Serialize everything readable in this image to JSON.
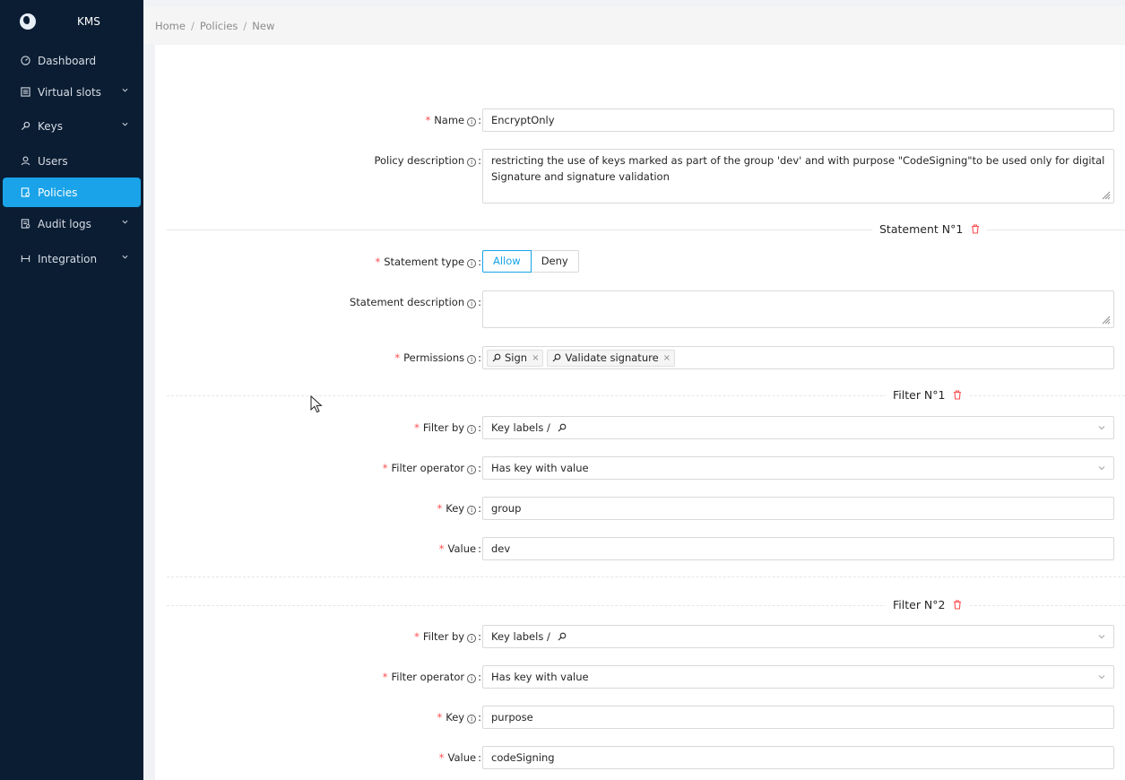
{
  "sidebar": {
    "app_title": "KMS",
    "items": [
      {
        "label": "Dashboard",
        "icon": "dashboard-icon",
        "expandable": false,
        "active": false
      },
      {
        "label": "Virtual slots",
        "icon": "slots-icon",
        "expandable": true,
        "active": false
      },
      {
        "label": "Keys",
        "icon": "key-icon",
        "expandable": true,
        "active": false
      },
      {
        "label": "Users",
        "icon": "user-icon",
        "expandable": false,
        "active": false
      },
      {
        "label": "Policies",
        "icon": "policy-icon",
        "expandable": false,
        "active": true
      },
      {
        "label": "Audit logs",
        "icon": "audit-icon",
        "expandable": true,
        "active": false
      },
      {
        "label": "Integration",
        "icon": "integration-icon",
        "expandable": true,
        "active": false
      }
    ]
  },
  "breadcrumb": [
    "Home",
    "Policies",
    "New"
  ],
  "form": {
    "name": {
      "label": "Name",
      "value": "EncryptOnly"
    },
    "policy_description": {
      "label": "Policy description",
      "value": "restricting the use of keys marked as part of the group 'dev'  and with purpose \"CodeSigning\"to be used only for digital Signature and signature validation"
    },
    "statement": {
      "title": "Statement N°1",
      "type_label": "Statement type",
      "type_options": [
        "Allow",
        "Deny"
      ],
      "type_selected": "Allow",
      "description_label": "Statement description",
      "description_value": "",
      "permissions_label": "Permissions",
      "permissions": [
        "Sign",
        "Validate signature"
      ]
    },
    "filters": [
      {
        "title": "Filter N°1",
        "filter_by_label": "Filter by",
        "filter_by_value": "Key labels /",
        "operator_label": "Filter operator",
        "operator_value": "Has key with value",
        "key_label": "Key",
        "key_value": "group",
        "value_label": "Value",
        "value_value": "dev"
      },
      {
        "title": "Filter N°2",
        "filter_by_label": "Filter by",
        "filter_by_value": "Key labels /",
        "operator_label": "Filter operator",
        "operator_value": "Has key with value",
        "key_label": "Key",
        "key_value": "purpose",
        "value_label": "Value",
        "value_value": "codeSigning"
      }
    ]
  },
  "colors": {
    "sidebar_bg": "#0b1d33",
    "accent": "#1aa3e8",
    "required": "#ff4d4f",
    "trash": "#ff4d4f"
  }
}
